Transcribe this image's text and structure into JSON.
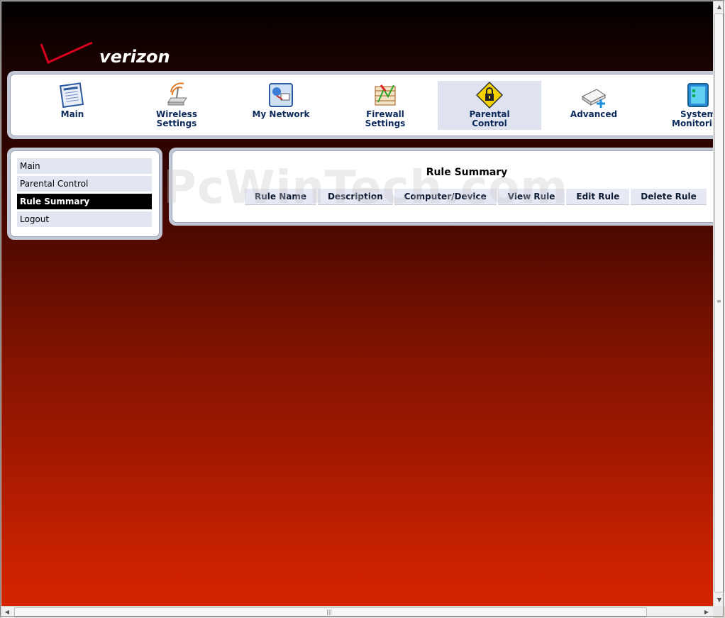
{
  "brand": {
    "name": "verizon"
  },
  "topnav": {
    "items": [
      {
        "label": "Main",
        "icon": "main-icon"
      },
      {
        "label": "Wireless\nSettings",
        "icon": "wireless-icon"
      },
      {
        "label": "My Network",
        "icon": "network-icon"
      },
      {
        "label": "Firewall\nSettings",
        "icon": "firewall-icon"
      },
      {
        "label": "Parental\nControl",
        "icon": "lock-icon",
        "active": true
      },
      {
        "label": "Advanced",
        "icon": "advanced-icon"
      },
      {
        "label": "System\nMonitoring",
        "icon": "monitor-icon"
      }
    ]
  },
  "sidebar": {
    "items": [
      {
        "label": "Main"
      },
      {
        "label": "Parental Control"
      },
      {
        "label": "Rule Summary",
        "selected": true
      },
      {
        "label": "Logout"
      }
    ]
  },
  "main": {
    "title": "Rule Summary",
    "columns": [
      "Rule Name",
      "Description",
      "Computer/Device",
      "View Rule",
      "Edit Rule",
      "Delete Rule"
    ]
  },
  "watermark": "PcWinTech.com",
  "colors": {
    "accent": "#cc2200",
    "nav_text": "#0d2a5c",
    "panel_border": "#c3c8d6",
    "selected_bg": "#000000"
  }
}
